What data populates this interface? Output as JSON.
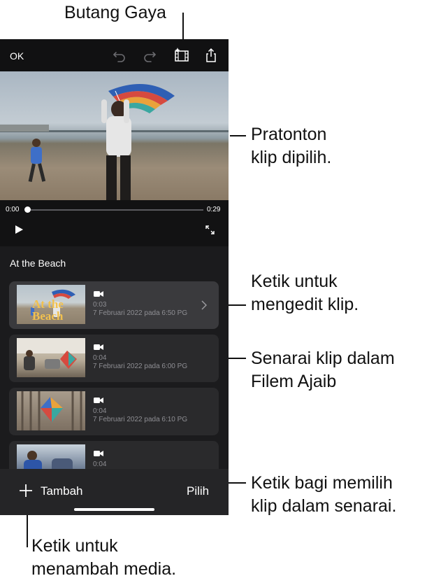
{
  "annotations": {
    "style_button": "Butang Gaya",
    "preview": "Pratonton\nklip dipilih.",
    "tap_edit": "Ketik untuk\nmengedit klip.",
    "clip_list": "Senarai klip dalam\nFilem Ajaib",
    "tap_select": "Ketik bagi memilih\nklip dalam senarai.",
    "tap_add": "Ketik untuk\nmenambah media."
  },
  "app": {
    "toolbar": {
      "ok_label": "OK",
      "icons": [
        "undo-icon",
        "redo-icon",
        "style-film-icon",
        "share-icon"
      ]
    },
    "player": {
      "time_start": "0:00",
      "time_end": "0:29",
      "progress": 0.0
    },
    "section_title": "At the Beach",
    "clips": [
      {
        "duration": "0:03",
        "date": "7 Februari 2022 pada 6:50 PG",
        "selected": true,
        "title_overlay": "At the\nBeach"
      },
      {
        "duration": "0:04",
        "date": "7 Februari 2022 pada 6:00 PG",
        "selected": false
      },
      {
        "duration": "0:04",
        "date": "7 Februari 2022 pada 6:10 PG",
        "selected": false
      },
      {
        "duration": "0:04",
        "date": "",
        "selected": false
      }
    ],
    "bottom": {
      "add_label": "Tambah",
      "select_label": "Pilih"
    },
    "colors": {
      "background": "#1b1b1d",
      "card": "#2a2a2c",
      "title_yellow": "#f2c14e"
    }
  }
}
